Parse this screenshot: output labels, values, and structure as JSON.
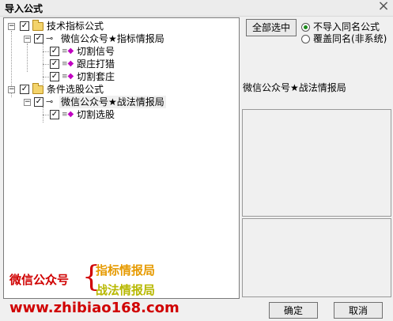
{
  "window": {
    "title": "导入公式",
    "close_glyph": "×"
  },
  "tree": {
    "nodes": [
      {
        "label": "技术指标公式",
        "expander": "−",
        "checked": "✓"
      },
      {
        "label": "微信公众号★指标情报局",
        "expander": "−",
        "checked": "✓"
      },
      {
        "label": "切割信号",
        "checked": "✓"
      },
      {
        "label": "跟庄打猎",
        "checked": "✓"
      },
      {
        "label": "切割套庄",
        "checked": "✓"
      },
      {
        "label": "条件选股公式",
        "expander": "−",
        "checked": "✓"
      },
      {
        "label": "微信公众号★战法情报局",
        "expander": "−",
        "checked": "✓"
      },
      {
        "label": "切割选股",
        "checked": "✓"
      }
    ]
  },
  "watermark": {
    "wechat": "微信公众号",
    "brace": "{",
    "line1": "指标情报局",
    "line2": "战法情报局",
    "url": "www.zhibiao168.com"
  },
  "controls": {
    "select_all": "全部选中",
    "radio_no_import": "不导入同名公式",
    "radio_overwrite": "覆盖同名(非系统)",
    "confirm": "确定",
    "cancel": "取消"
  },
  "info": {
    "name": "微信公众号★战法情报局"
  },
  "colors": {
    "wechat_red": "#d00000",
    "orange": "#e69a00",
    "olive": "#b8b800",
    "folder": "#f3d36b"
  }
}
